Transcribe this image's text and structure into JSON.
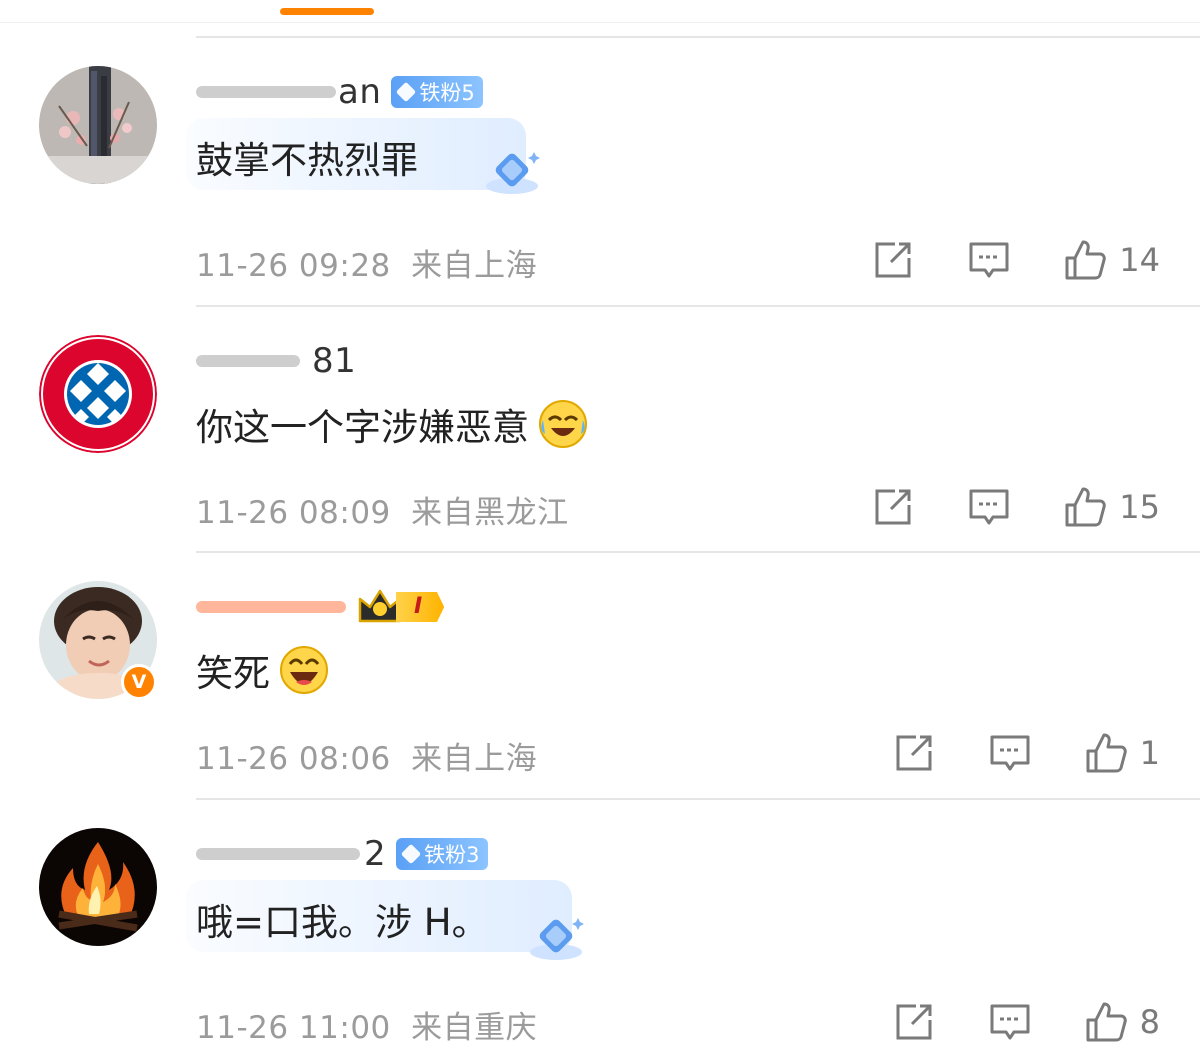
{
  "colors": {
    "accent": "#ff8200",
    "text_primary": "#222222",
    "text_secondary": "#9b9b9b",
    "divider": "#e6e6e6",
    "fan_badge": "#5aa0f5"
  },
  "comments": [
    {
      "username_visible": "an",
      "badge": "铁粉5",
      "text": "鼓掌不热烈罪",
      "time": "11-26 09:28",
      "location": "来自上海",
      "likes": "14",
      "icons": [
        "share-icon",
        "reply-icon",
        "like-icon"
      ]
    },
    {
      "username_visible": "81",
      "text": "你这一个字涉嫌恶意",
      "emoji": "laugh-cry-emoji",
      "time": "11-26 08:09",
      "location": "来自黑龙江",
      "likes": "15",
      "icons": [
        "share-icon",
        "reply-icon",
        "like-icon"
      ]
    },
    {
      "vip_level": "I",
      "verified": "V",
      "text": "笑死",
      "emoji": "laughing-emoji",
      "time": "11-26 08:06",
      "location": "来自上海",
      "likes": "1",
      "icons": [
        "share-icon",
        "reply-icon",
        "like-icon"
      ]
    },
    {
      "username_visible": "2",
      "badge": "铁粉3",
      "text": "哦=口我。涉 H。",
      "time": "11-26 11:00",
      "location": "来自重庆",
      "likes": "8",
      "icons": [
        "share-icon",
        "reply-icon",
        "like-icon"
      ]
    }
  ]
}
